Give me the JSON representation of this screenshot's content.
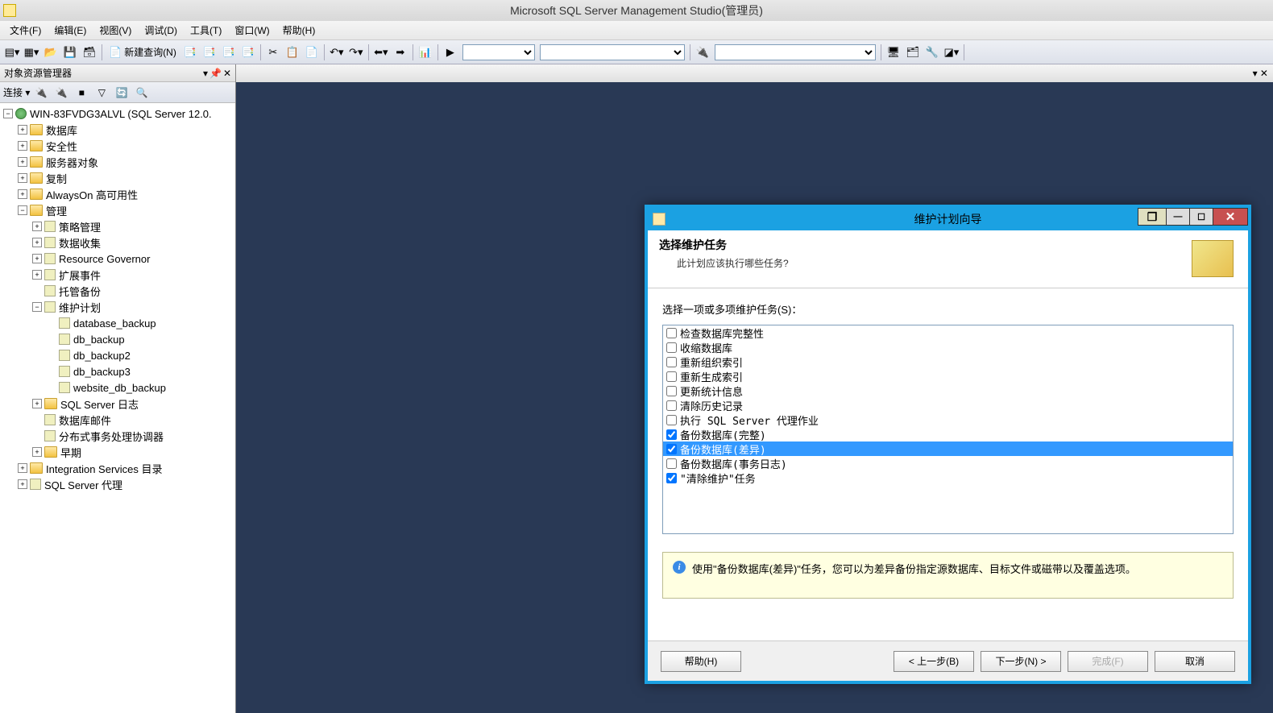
{
  "titlebar": {
    "text": "Microsoft SQL Server Management Studio(管理员)"
  },
  "menu": {
    "file": "文件(F)",
    "edit": "编辑(E)",
    "view": "视图(V)",
    "debug": "调试(D)",
    "tools": "工具(T)",
    "window": "窗口(W)",
    "help": "帮助(H)"
  },
  "toolbar": {
    "newQuery": "新建查询(N)"
  },
  "sidebar": {
    "title": "对象资源管理器",
    "connect": "连接 ▾",
    "server": "WIN-83FVDG3ALVL (SQL Server 12.0.",
    "nodes": {
      "databases": "数据库",
      "security": "安全性",
      "serverObjects": "服务器对象",
      "replication": "复制",
      "alwayson": "AlwaysOn 高可用性",
      "management": "管理",
      "policy": "策略管理",
      "dataCollection": "数据收集",
      "resourceGovernor": "Resource Governor",
      "extendedEvents": "扩展事件",
      "managedBackup": "托管备份",
      "maintenancePlans": "维护计划",
      "plan1": "database_backup",
      "plan2": "db_backup",
      "plan3": "db_backup2",
      "plan4": "db_backup3",
      "plan5": "website_db_backup",
      "sqlLogs": "SQL Server 日志",
      "dbMail": "数据库邮件",
      "dtc": "分布式事务处理协调器",
      "legacy": "早期",
      "integrationServices": "Integration Services 目录",
      "sqlAgent": "SQL Server 代理"
    }
  },
  "dialog": {
    "title": "维护计划向导",
    "headerTitle": "选择维护任务",
    "headerSub": "此计划应该执行哪些任务?",
    "selectLabel": "选择一项或多项维护任务(S)：",
    "tasks": [
      {
        "label": "检查数据库完整性",
        "checked": false,
        "selected": false
      },
      {
        "label": "收缩数据库",
        "checked": false,
        "selected": false
      },
      {
        "label": "重新组织索引",
        "checked": false,
        "selected": false
      },
      {
        "label": "重新生成索引",
        "checked": false,
        "selected": false
      },
      {
        "label": "更新统计信息",
        "checked": false,
        "selected": false
      },
      {
        "label": "清除历史记录",
        "checked": false,
        "selected": false
      },
      {
        "label": "执行 SQL Server 代理作业",
        "checked": false,
        "selected": false
      },
      {
        "label": "备份数据库(完整)",
        "checked": true,
        "selected": false
      },
      {
        "label": "备份数据库(差异)",
        "checked": true,
        "selected": true
      },
      {
        "label": "备份数据库(事务日志)",
        "checked": false,
        "selected": false
      },
      {
        "label": "\"清除维护\"任务",
        "checked": true,
        "selected": false
      }
    ],
    "info": "使用\"备份数据库(差异)\"任务，您可以为差异备份指定源数据库、目标文件或磁带以及覆盖选项。",
    "buttons": {
      "help": "帮助(H)",
      "back": "< 上一步(B)",
      "next": "下一步(N) >",
      "finish": "完成(F)",
      "cancel": "取消"
    }
  }
}
